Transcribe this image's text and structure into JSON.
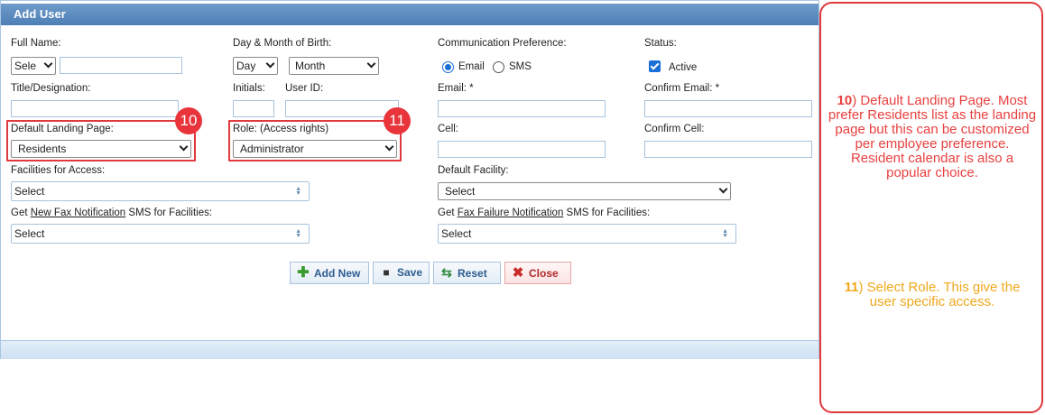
{
  "header": {
    "title": "Add User"
  },
  "form": {
    "full_name": {
      "label": "Full Name:",
      "prefix_value": "Sele",
      "value": ""
    },
    "dob": {
      "label": "Day & Month of Birth:",
      "day_value": "Day",
      "month_value": "Month"
    },
    "communication": {
      "label": "Communication Preference:",
      "email_label": "Email",
      "sms_label": "SMS",
      "selected": "Email"
    },
    "status": {
      "label": "Status:",
      "active_label": "Active",
      "active_checked": true
    },
    "title": {
      "label": "Title/Designation:",
      "value": ""
    },
    "initials": {
      "label": "Initials:",
      "value": ""
    },
    "user_id": {
      "label": "User ID:",
      "value": ""
    },
    "email": {
      "label": "Email: *",
      "value": ""
    },
    "confirm_email": {
      "label": "Confirm Email: *",
      "value": ""
    },
    "landing_page": {
      "label": "Default Landing Page:",
      "value": "Residents"
    },
    "role": {
      "label": "Role: (Access rights)",
      "value": "Administrator"
    },
    "cell": {
      "label": "Cell:",
      "value": ""
    },
    "confirm_cell": {
      "label": "Confirm Cell:",
      "value": ""
    },
    "facilities_access": {
      "label": "Facilities for Access:",
      "value": "Select"
    },
    "default_facility": {
      "label": "Default Facility:",
      "value": "Select"
    },
    "fax_notification": {
      "label_pre": "Get ",
      "label_link": "New Fax Notification",
      "label_post": " SMS for Facilities:",
      "value": "Select"
    },
    "fax_failure": {
      "label_pre": "Get ",
      "label_link": "Fax Failure Notification",
      "label_post": " SMS for Facilities:",
      "value": "Select"
    }
  },
  "buttons": {
    "add_new": "Add New",
    "save": "Save",
    "reset": "Reset",
    "close": "Close"
  },
  "badges": {
    "landing": "10",
    "role": "11"
  },
  "notes": {
    "note10_num": "10",
    "note10_text": ") Default Landing Page. Most prefer Residents list as the landing page but this can be customized per employee preference. Resident calendar is also a popular choice.",
    "note11_num": "11",
    "note11_text": ") Select Role. This give the user specific access."
  },
  "colors": {
    "header_bg": "#5a8bc0",
    "highlight_red": "#e0393e",
    "note10_color": "#e8403f",
    "note11_color": "#f0a81c"
  }
}
